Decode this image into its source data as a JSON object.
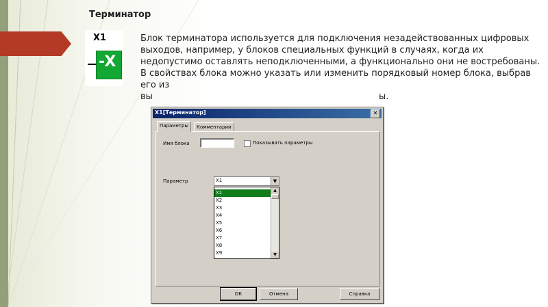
{
  "slide": {
    "title": "Терминатор",
    "block_label": "X1",
    "block_symbol": "-X",
    "paragraph1": "Блок терминатора используется для подключения незадействованных цифровых выходов, например, у блоков специальных функций в случаях, когда их недопустимо оставлять неподключенными, а функционально они не востребованы.",
    "paragraph2_a": "В свойствах блока можно указать или изменить порядковый номер блока, выбрав его из",
    "paragraph2_b": "вы",
    "paragraph2_tail": "ы."
  },
  "dialog": {
    "title": "X1[Терминатор]",
    "close": "✕",
    "tabs": [
      "Параметры",
      "Комментарии"
    ],
    "name_label": "Имя блока",
    "name_value": "",
    "show_params_label": "Показывать параметры",
    "param_label": "Параметр",
    "param_selected": "X1",
    "options": [
      "X1",
      "X2",
      "X3",
      "X4",
      "X5",
      "X6",
      "X7",
      "X8",
      "X9"
    ],
    "buttons": {
      "ok": "ОК",
      "cancel": "Отмена",
      "help": "Справка"
    }
  },
  "colors": {
    "accent_arrow": "#b53a26",
    "block_green": "#13a833",
    "selection_green": "#107c1a"
  }
}
